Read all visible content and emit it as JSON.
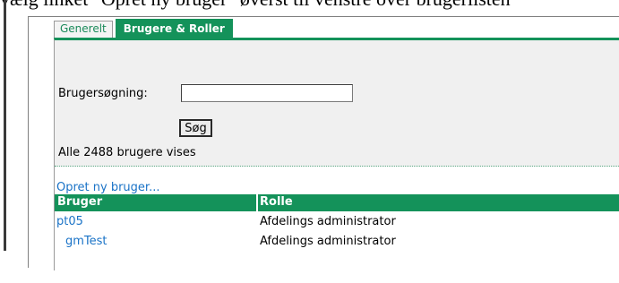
{
  "top_text": "vælg linket \"Opret ny bruger\" øverst til venstre over brugerlisten",
  "tabs": [
    {
      "label": "Generelt"
    },
    {
      "label": "Brugere & Roller"
    }
  ],
  "search": {
    "label": "Brugersøgning:",
    "value": "",
    "button_label": "Søg"
  },
  "count_text": "Alle 2488 brugere vises",
  "create_link": "Opret ny bruger...",
  "table": {
    "headers": [
      "Bruger",
      "Rolle"
    ],
    "rows": [
      {
        "user": "pt05",
        "role": "Afdelings administrator"
      },
      {
        "user": "gmTest",
        "role": "Afdelings administrator"
      }
    ]
  },
  "colors": {
    "accent_green": "#14925a",
    "link_blue": "#1a73c7",
    "panel_bg": "#f0f0f0"
  }
}
